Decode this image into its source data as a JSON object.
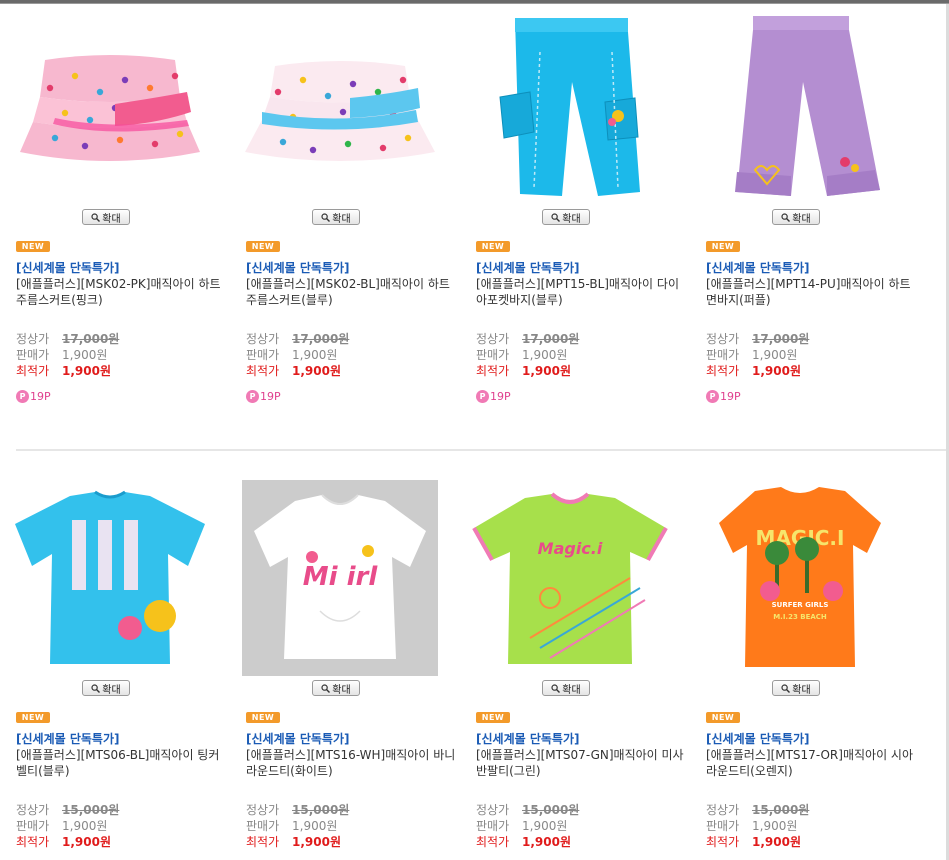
{
  "zoom_label": "확대",
  "new_badge": "NEW",
  "labels": {
    "list_price": "정상가",
    "sale_price": "판매가",
    "best_price": "최적가"
  },
  "products": [
    {
      "promo": "[신세계몰 단독특가]",
      "name": "[애플플러스][MSK02-PK]매직아이 하트주름스커트(핑크)",
      "list_price": "17,000원",
      "sale_price": "1,900원",
      "best_price": "1,900원",
      "points": "19P",
      "image": "pink-tiered-skirt"
    },
    {
      "promo": "[신세계몰 단독특가]",
      "name": "[애플플러스][MSK02-BL]매직아이 하트주름스커트(블루)",
      "list_price": "17,000원",
      "sale_price": "1,900원",
      "best_price": "1,900원",
      "points": "19P",
      "image": "blue-tiered-skirt"
    },
    {
      "promo": "[신세계몰 단독특가]",
      "name": "[애플플러스][MPT15-BL]매직아이 다이아포켓바지(블루)",
      "list_price": "17,000원",
      "sale_price": "1,900원",
      "best_price": "1,900원",
      "points": "19P",
      "image": "blue-cargo-pants"
    },
    {
      "promo": "[신세계몰 단독특가]",
      "name": "[애플플러스][MPT14-PU]매직아이 하트면바지(퍼플)",
      "list_price": "17,000원",
      "sale_price": "1,900원",
      "best_price": "1,900원",
      "points": "19P",
      "image": "purple-pants"
    },
    {
      "promo": "[신세계몰 단독특가]",
      "name": "[애플플러스][MTS06-BL]매직아이 팅커벨티(블루)",
      "list_price": "15,000원",
      "sale_price": "1,900원",
      "best_price": "1,900원",
      "points": "",
      "image": "blue-tshirt"
    },
    {
      "promo": "[신세계몰 단독특가]",
      "name": "[애플플러스][MTS16-WH]매직아이 바니라운드티(화이트)",
      "list_price": "15,000원",
      "sale_price": "1,900원",
      "best_price": "1,900원",
      "points": "",
      "image": "white-tshirt"
    },
    {
      "promo": "[신세계몰 단독특가]",
      "name": "[애플플러스][MTS07-GN]매직아이 미사반팔티(그린)",
      "list_price": "15,000원",
      "sale_price": "1,900원",
      "best_price": "1,900원",
      "points": "",
      "image": "green-tshirt"
    },
    {
      "promo": "[신세계몰 단독특가]",
      "name": "[애플플러스][MTS17-OR]매직아이 시아라운드티(오렌지)",
      "list_price": "15,000원",
      "sale_price": "1,900원",
      "best_price": "1,900원",
      "points": "",
      "image": "orange-tshirt"
    }
  ],
  "graphic_text": {
    "magic_logo": "Magic.i",
    "mi_girl": "Mi  irl",
    "magic_caps": "MAGIC.I",
    "surfer": "SURFER GIRLS",
    "beach": "M.I.23 BEACH"
  }
}
